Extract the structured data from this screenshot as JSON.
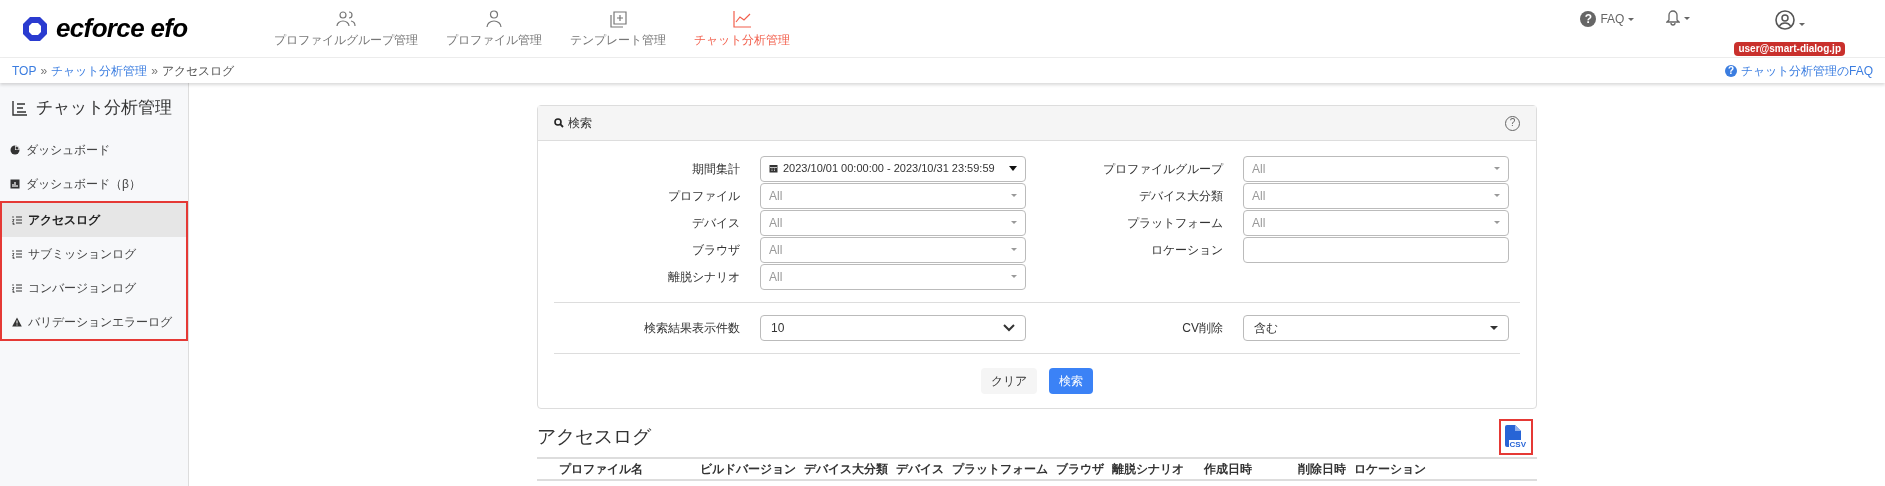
{
  "header": {
    "logo": "ecforce efo",
    "nav": [
      {
        "label": "プロファイルグループ管理",
        "selected": false
      },
      {
        "label": "プロファイル管理",
        "selected": false
      },
      {
        "label": "テンプレート管理",
        "selected": false
      },
      {
        "label": "チャット分析管理",
        "selected": true
      }
    ],
    "faq_icon": "?",
    "faq": "FAQ",
    "user_email": "user@smart-dialog.jp"
  },
  "breadcrumb": [
    {
      "label": "TOP",
      "link": true
    },
    {
      "separator": "»",
      "label": "チャット分析管理",
      "link": true
    },
    {
      "separator": "»",
      "label": "アクセスログ",
      "link": false
    }
  ],
  "faq_link_icon": "?",
  "faq_link": "チャット分析管理のFAQ",
  "sidebar": {
    "title": "チャット分析管理",
    "items": [
      {
        "label": "ダッシュボード",
        "selected": false,
        "highlighted": false
      },
      {
        "label": "ダッシュボード（β）",
        "selected": false,
        "highlighted": false
      },
      {
        "label": "アクセスログ",
        "selected": true,
        "highlighted": true
      },
      {
        "label": "サブミッションログ",
        "selected": false,
        "highlighted": true
      },
      {
        "label": "コンバージョンログ",
        "selected": false,
        "highlighted": true
      },
      {
        "label": "バリデーションエラーログ",
        "selected": false,
        "highlighted": true
      }
    ]
  },
  "search": {
    "title": "検索",
    "help_icon": "?",
    "fields_left": [
      {
        "label": "期間集計",
        "kind": "daterange",
        "value": "2023/10/01 00:00:00 - 2023/10/31 23:59:59"
      },
      {
        "label": "プロファイル",
        "kind": "select",
        "placeholder": "All"
      },
      {
        "label": "デバイス",
        "kind": "select",
        "placeholder": "All"
      },
      {
        "label": "ブラウザ",
        "kind": "select",
        "placeholder": "All"
      },
      {
        "label": "離脱シナリオ",
        "kind": "select",
        "placeholder": "All"
      }
    ],
    "fields_right": [
      {
        "label": "プロファイルグループ",
        "kind": "select",
        "placeholder": "All"
      },
      {
        "label": "デバイス大分類",
        "kind": "select",
        "placeholder": "All"
      },
      {
        "label": "プラットフォーム",
        "kind": "select",
        "placeholder": "All"
      },
      {
        "label": "ロケーション",
        "kind": "text"
      }
    ],
    "results_count": {
      "label": "検索結果表示件数",
      "value": "10"
    },
    "cv_exclude": {
      "label": "CV削除",
      "value": "含む"
    },
    "buttons": [
      {
        "label": "クリア",
        "kind": "secondary"
      },
      {
        "label": "検索",
        "kind": "primary"
      }
    ]
  },
  "table": {
    "title": "アクセスログ",
    "csv_label": "CSV",
    "csv_highlighted": true,
    "columns": [
      "プロファイル名",
      "ビルドバージョン",
      "デバイス大分類",
      "デバイス",
      "プラットフォーム",
      "ブラウザ",
      "離脱シナリオ",
      "作成日時",
      "削除日時",
      "ロケーション"
    ]
  }
}
